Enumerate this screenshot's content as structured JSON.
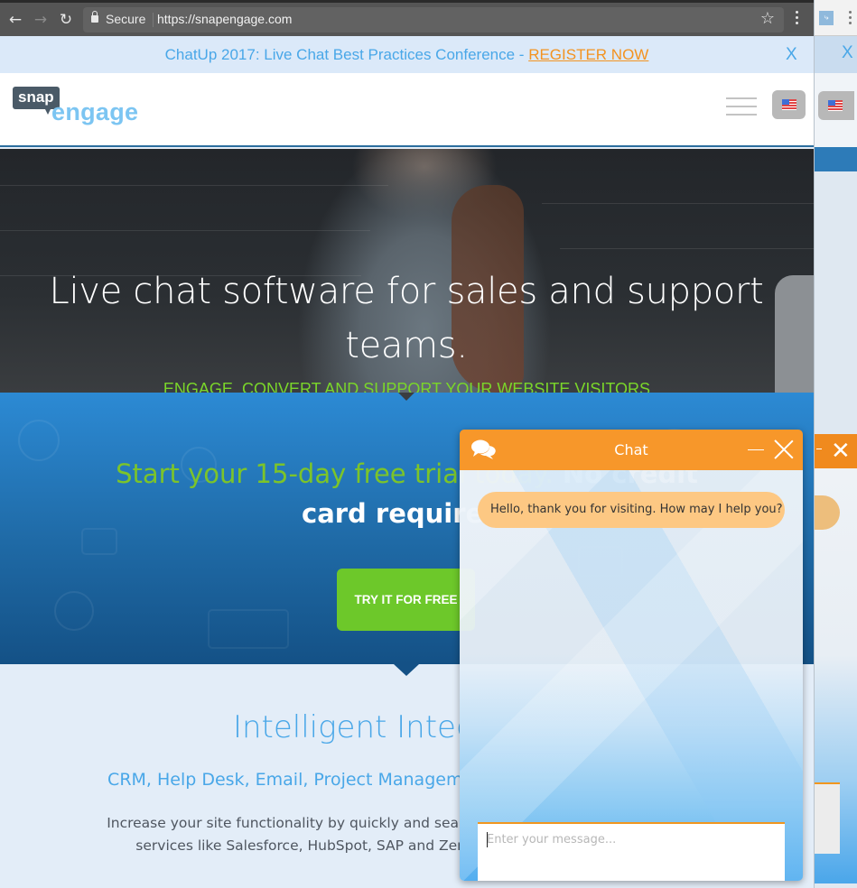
{
  "browser": {
    "back_icon": "arrow-left-icon",
    "forward_icon": "arrow-right-icon",
    "reload_icon": "reload-icon",
    "secure_label": "Secure",
    "url": "https://snapengage.com",
    "bookmark_icon": "star-icon",
    "menu_icon": "kebab-icon"
  },
  "banner": {
    "text": "ChatUp 2017: Live Chat Best Practices Conference - ",
    "link_label": "REGISTER NOW",
    "close_label": "X"
  },
  "header": {
    "logo_top": "snap",
    "logo_bottom": "engage",
    "menu_icon": "hamburger-icon",
    "language_icon": "us-flag-icon"
  },
  "hero": {
    "title": "Live chat software for sales and support teams.",
    "tagline": "ENGAGE, CONVERT AND SUPPORT YOUR WEBSITE VISITORS"
  },
  "trial": {
    "line1_green": "Start your 15-day free trial today.",
    "line1_white": " No credit",
    "line2": "card required.",
    "cta_label": "TRY IT FOR FREE"
  },
  "integrations": {
    "title": "Intelligent Integrations",
    "subtitle": "CRM, Help Desk, Email, Project Management, Marketing, Social Media",
    "body": "Increase your site functionality by quickly and seamlessly integrating with third party services like Salesforce, HubSpot, SAP and Zendesk, which you use regularly."
  },
  "chat": {
    "title": "Chat",
    "icon": "chat-bubbles-icon",
    "minimize_icon": "minimize-icon",
    "close_icon": "close-icon",
    "messages": [
      {
        "from": "agent",
        "text": "Hello, thank you for visiting. How may I help you?"
      }
    ],
    "input_placeholder": "Enter your message...",
    "input_value": ""
  },
  "side_window": {
    "close_label": "X"
  },
  "colors": {
    "brand_blue": "#49a7e8",
    "accent_orange": "#f7972a",
    "cta_green": "#6dc82a",
    "tagline_green": "#7ad62a"
  }
}
